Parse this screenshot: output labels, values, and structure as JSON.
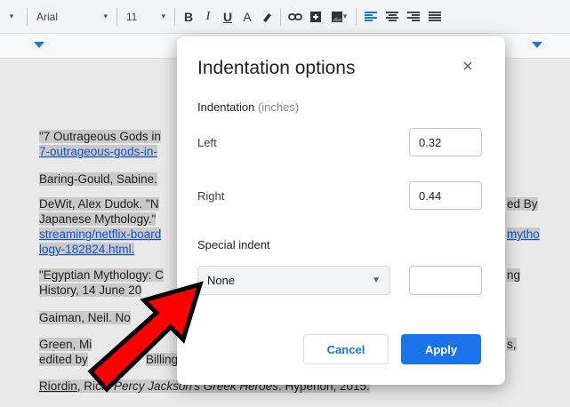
{
  "toolbar": {
    "font_name": "Arial",
    "font_size": "11",
    "bold": "B",
    "italic": "I",
    "underline": "U",
    "text_color": "A"
  },
  "document": {
    "p1a": "\"7 Outrageous Gods in",
    "p1b": "7-outrageous-gods-in-",
    "p2": "Baring-Gould, Sabine.",
    "p3a": "DeWit, Alex Dudok. \"N",
    "p3b": "Japanese Mythology.\"",
    "p3c": "streaming/netflix-board",
    "p3d": "logy-182824.html.",
    "p3r1": "ed By",
    "p3r2": "mytho",
    "p4a": "\"Egyptian Mythology: C",
    "p4b": "History, 14 June 20",
    "p4r": "ng",
    "p5": "Gaiman, Neil. No",
    "p6a": "Green, Mi",
    "p6b": "edited by",
    "p6c": "Billing",
    "p6r": "s,",
    "p7a": "Riordin",
    "p7b": ", Rick. ",
    "p7c": "Percy Jackson's Greek Heroes",
    "p7d": ". Hyperion, 2015."
  },
  "dialog": {
    "title": "Indentation options",
    "close": "×",
    "section_label": "Indentation",
    "section_units": "(inches)",
    "left_label": "Left",
    "left_value": "0.32",
    "right_label": "Right",
    "right_value": "0.44",
    "special_label": "Special indent",
    "special_selected": "None",
    "special_value": "",
    "cancel": "Cancel",
    "apply": "Apply"
  },
  "colors": {
    "accent": "#1a73e8",
    "arrow": "#ff0000"
  }
}
